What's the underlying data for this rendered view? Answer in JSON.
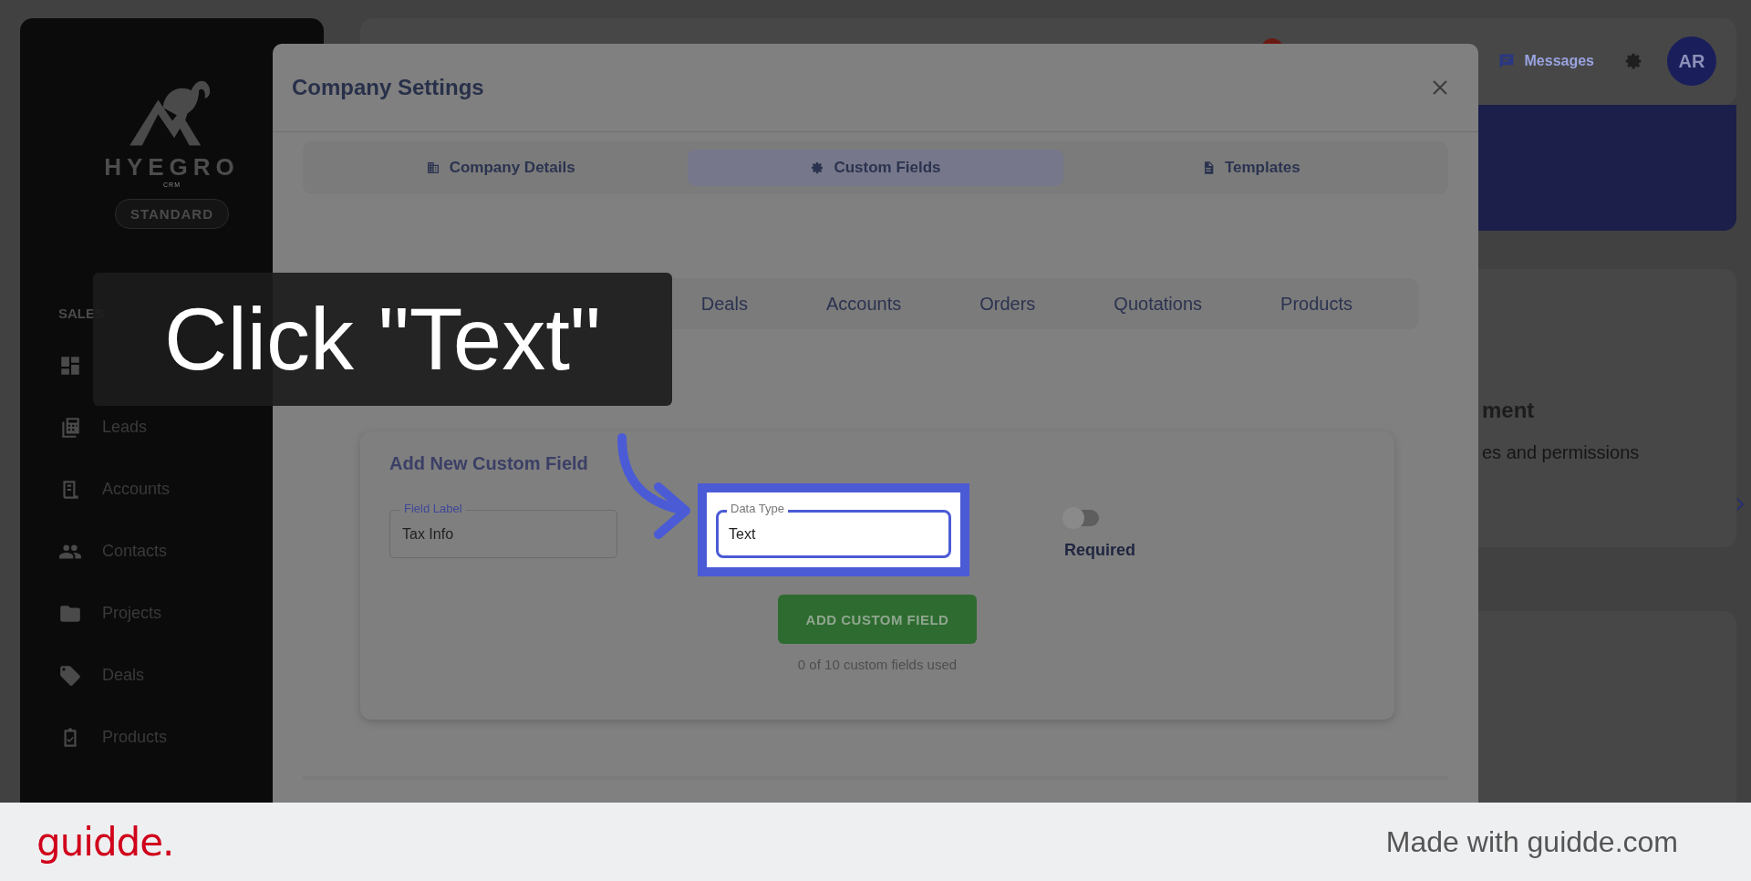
{
  "sidebar": {
    "brand": "HYEGRO",
    "brand_sub": "CRM",
    "plan": "STANDARD",
    "section": "SALES",
    "items": [
      {
        "label": "Leads"
      },
      {
        "label": "Accounts"
      },
      {
        "label": "Contacts"
      },
      {
        "label": "Projects"
      },
      {
        "label": "Deals"
      },
      {
        "label": "Products"
      }
    ]
  },
  "header": {
    "messages": "Messages",
    "avatar": "AR"
  },
  "background_card": {
    "title": "ment",
    "text": "es and permissions"
  },
  "modal": {
    "title": "Company Settings",
    "tabs": [
      {
        "label": "Company Details",
        "selected": false
      },
      {
        "label": "Custom Fields",
        "selected": true
      },
      {
        "label": "Templates",
        "selected": false
      }
    ],
    "subtabs": [
      {
        "label": "Deals"
      },
      {
        "label": "Accounts"
      },
      {
        "label": "Orders"
      },
      {
        "label": "Quotations"
      },
      {
        "label": "Products"
      }
    ],
    "form": {
      "heading": "Add New Custom Field",
      "fields": [
        {
          "label": "Field Label",
          "value": "Tax Info",
          "highlighted": false
        },
        {
          "label": "Data Type",
          "value": "Text",
          "highlighted": true
        }
      ],
      "toggle": {
        "label": "Required",
        "on": false
      },
      "button": "ADD CUSTOM FIELD",
      "usage": "0 of 10 custom fields used"
    }
  },
  "guide": {
    "caption": "Click \"Text\""
  },
  "footer": {
    "logo": "guidde.",
    "credit": "Made with guidde.com"
  }
}
